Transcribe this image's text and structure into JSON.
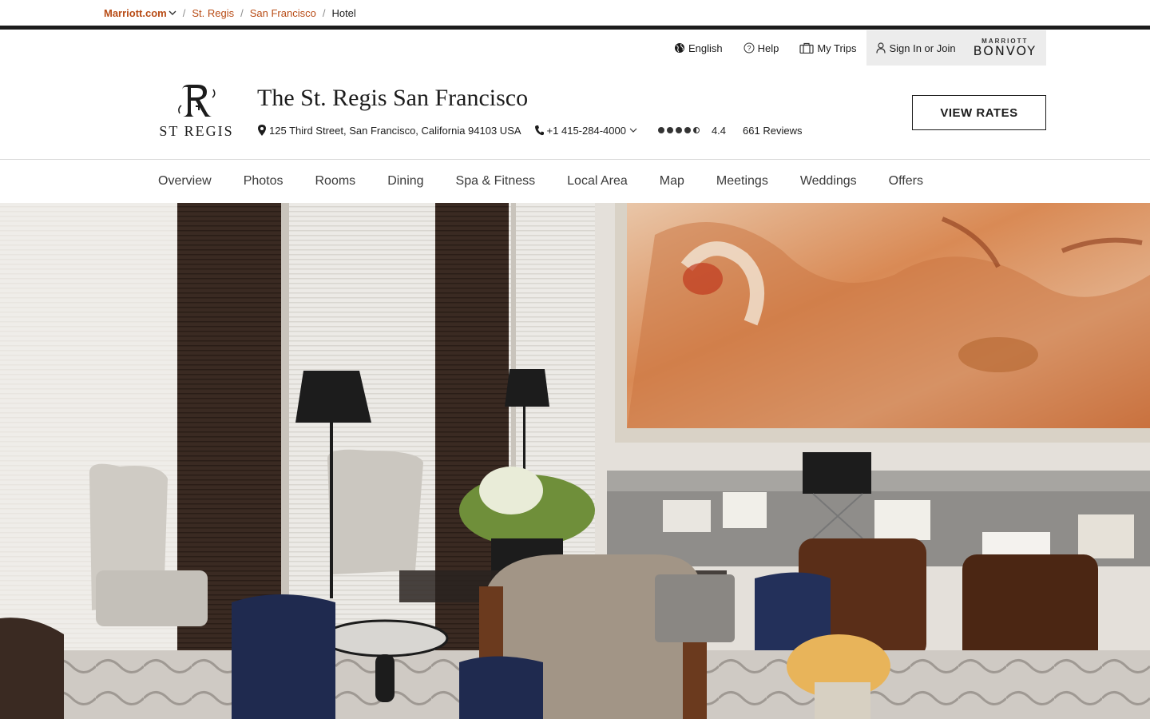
{
  "breadcrumb": {
    "home": "Marriott.com",
    "items": [
      "St. Regis",
      "San Francisco"
    ],
    "current": "Hotel"
  },
  "utility": {
    "language": "English",
    "help": "Help",
    "trips": "My Trips",
    "signin": "Sign In or Join",
    "bonvoy_top": "MARRIOTT",
    "bonvoy_main": "BONVOY"
  },
  "brand": {
    "logo_text": "ST REGIS"
  },
  "hotel": {
    "name": "The St. Regis San Francisco",
    "address": "125 Third Street, San Francisco, California 94103 USA",
    "phone": "+1 415-284-4000",
    "rating": "4.4",
    "rating_value": 4.4,
    "reviews": "661 Reviews",
    "cta": "VIEW RATES"
  },
  "nav": [
    "Overview",
    "Photos",
    "Rooms",
    "Dining",
    "Spa & Fitness",
    "Local Area",
    "Map",
    "Meetings",
    "Weddings",
    "Offers"
  ],
  "colors": {
    "accent": "#b84c16",
    "dark": "#1c1c1c",
    "utility_bg": "#ececec"
  },
  "icons": [
    "chevron-down-icon",
    "globe-icon",
    "help-icon",
    "suitcase-icon",
    "user-icon",
    "location-pin-icon",
    "phone-icon"
  ]
}
